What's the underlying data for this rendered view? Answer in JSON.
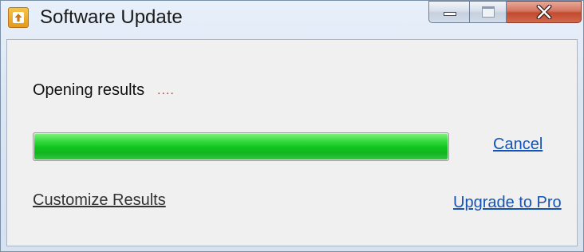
{
  "window": {
    "title": "Software Update",
    "icon": "update-arrow-icon",
    "accent_color": "#e49a1c"
  },
  "caption": {
    "minimize_icon": "minimize-icon",
    "maximize_icon": "maximize-icon",
    "close_icon": "close-icon"
  },
  "status": {
    "text": "Opening results",
    "dots": "...."
  },
  "progress": {
    "value_percent": 100,
    "color": "#0fc21d"
  },
  "links": {
    "cancel": "Cancel",
    "customize": "Customize Results",
    "upgrade": "Upgrade to Pro"
  }
}
